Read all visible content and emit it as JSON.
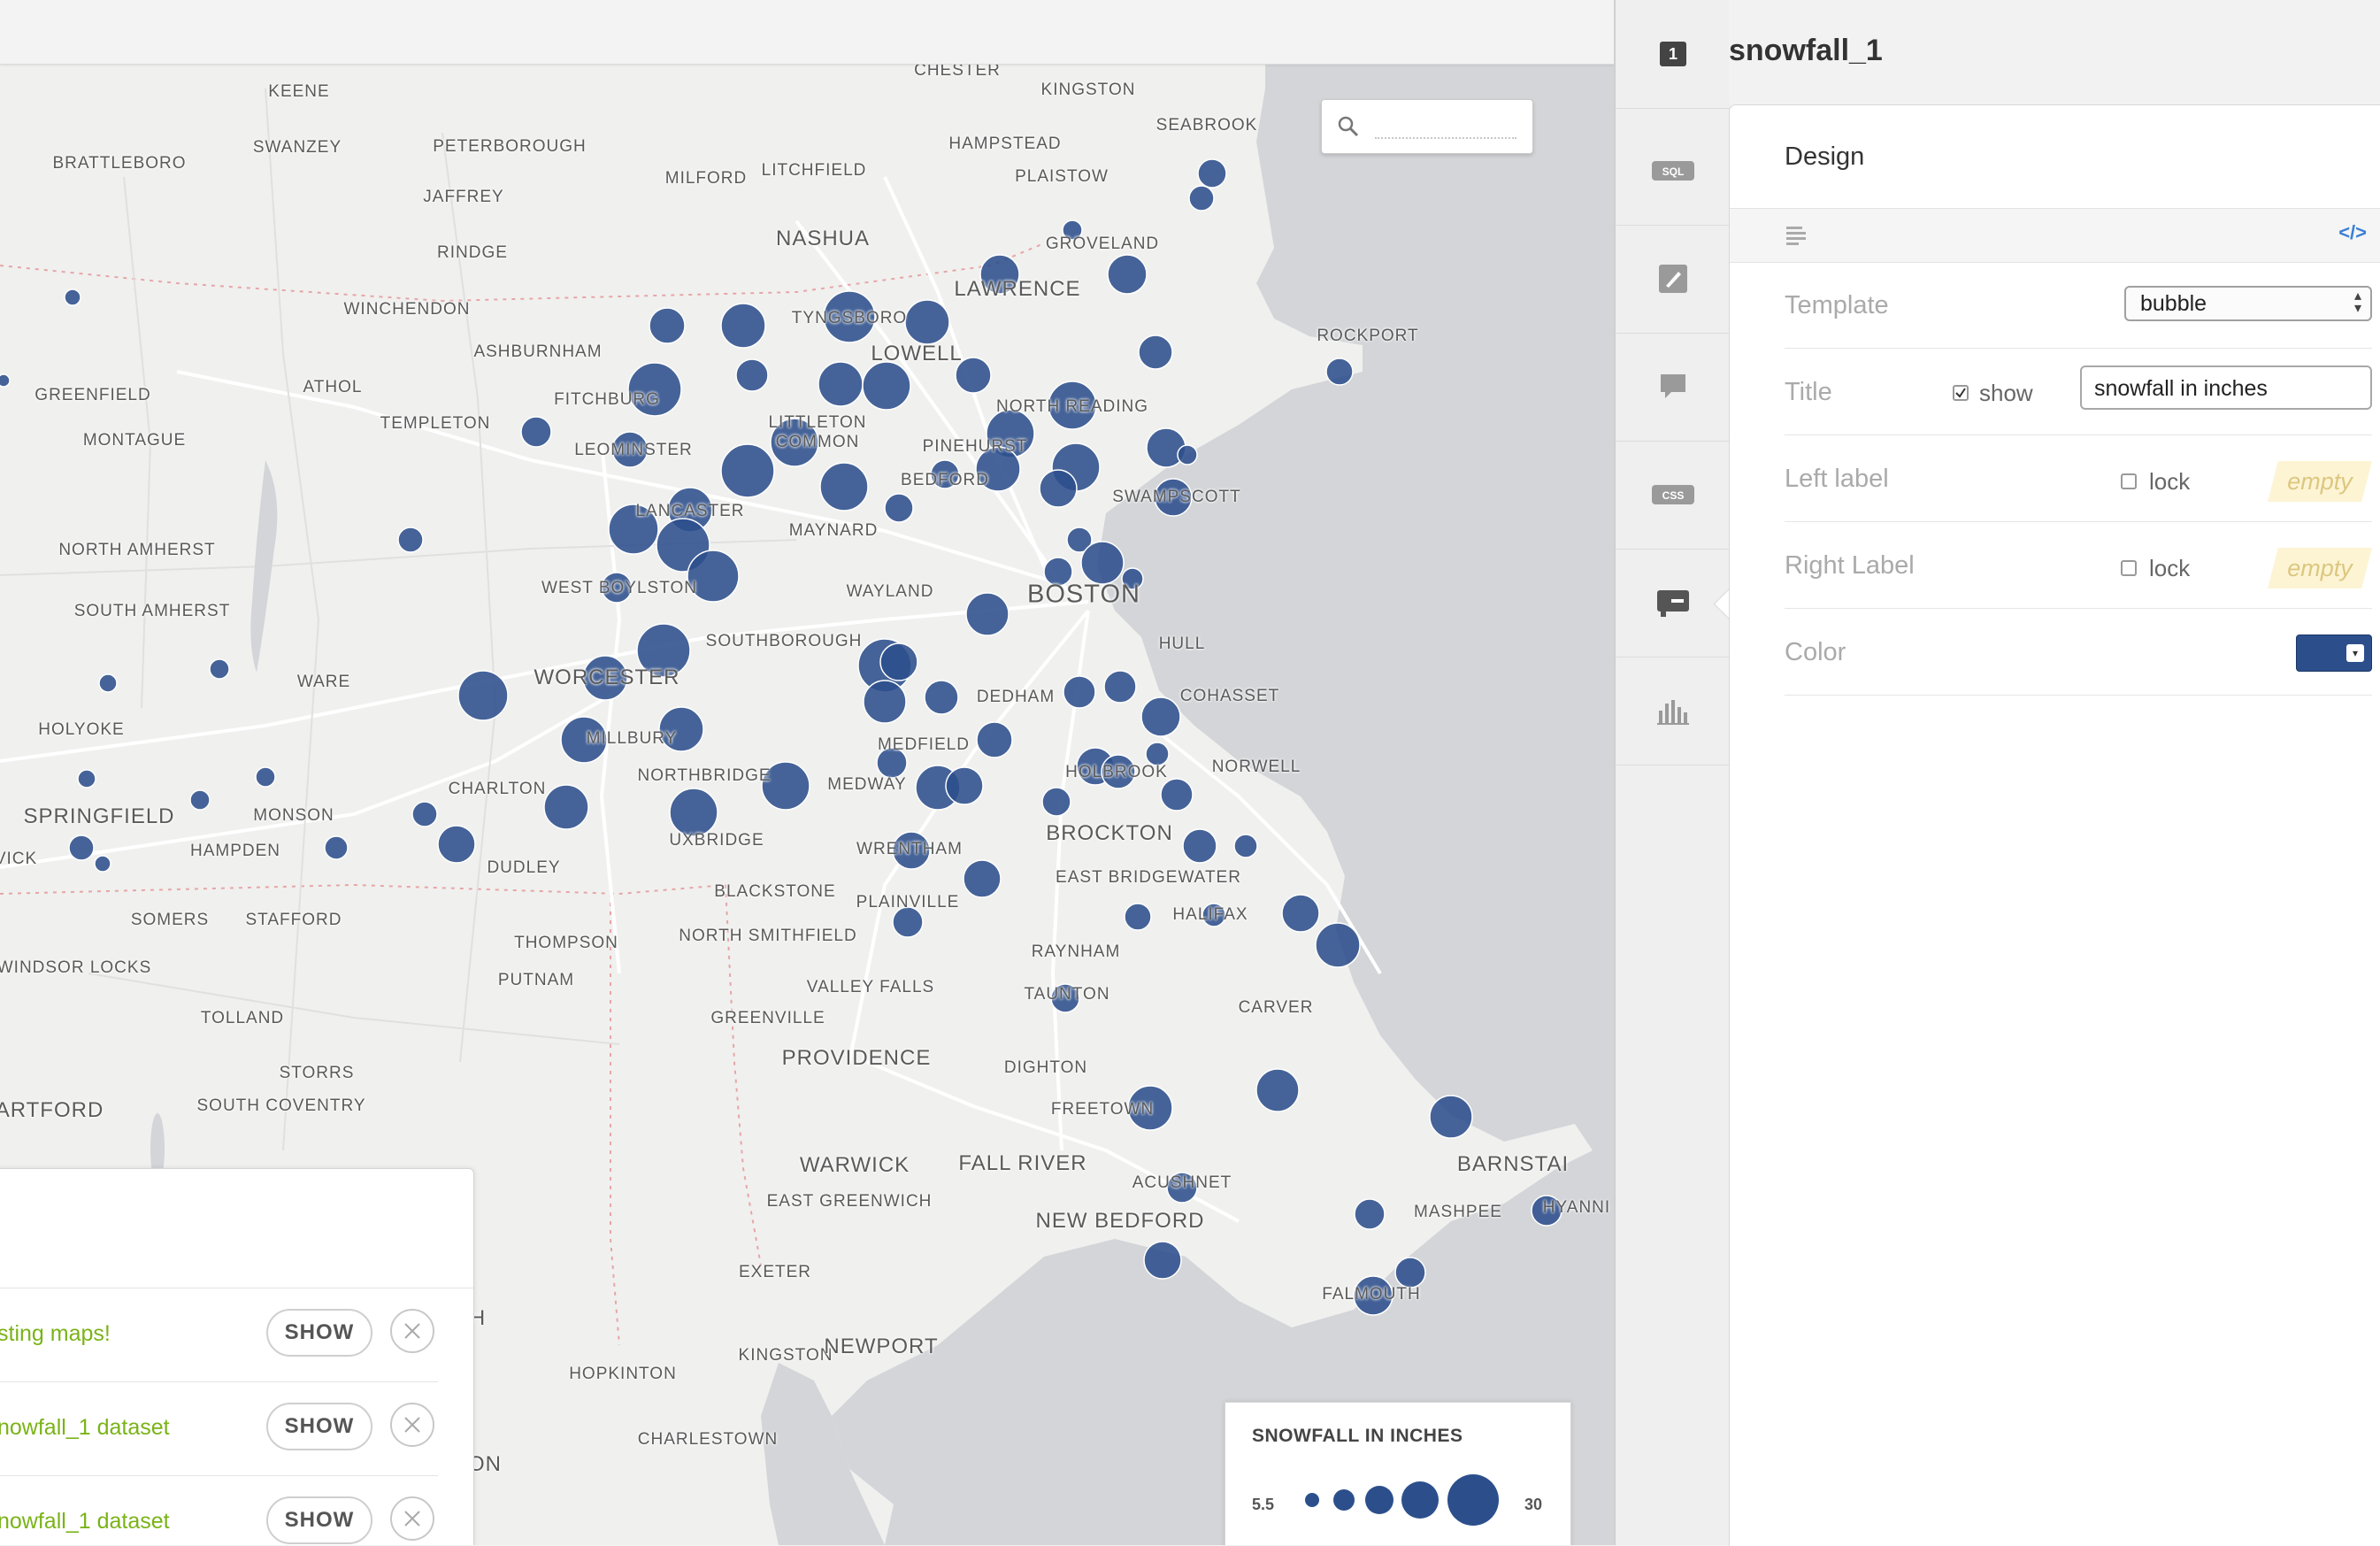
{
  "layer": {
    "number": "1",
    "name": "snowfall_1"
  },
  "rail_icons": [
    "sql-icon",
    "wizard-icon",
    "infowindow-icon",
    "css-icon",
    "legend-icon",
    "widgets-icon"
  ],
  "panel": {
    "title": "Design",
    "code_toggle": "</>",
    "template": {
      "label": "Template",
      "value": "bubble"
    },
    "title_row": {
      "label": "Title",
      "show_label": "show",
      "show_checked": true,
      "value": "snowfall in inches"
    },
    "left_label": {
      "label": "Left label",
      "lock_label": "lock",
      "placeholder": "empty"
    },
    "right_label": {
      "label": "Right Label",
      "lock_label": "lock",
      "placeholder": "empty"
    },
    "color": {
      "label": "Color",
      "value": "#2c4f8c"
    }
  },
  "legend": {
    "title": "SNOWFALL IN INCHES",
    "min": "5.5",
    "max": "30"
  },
  "notifications": [
    {
      "text": "sting maps!",
      "button": "SHOW"
    },
    {
      "text": "nowfall_1 dataset",
      "button": "SHOW"
    },
    {
      "text": "nowfall_1 dataset",
      "button": "SHOW"
    }
  ],
  "map": {
    "partial_label": "H",
    "partial_label2": "ON",
    "places": [
      {
        "n": "CHESTER",
        "s": "s"
      },
      {
        "n": "KINGSTON",
        "s": "s"
      },
      {
        "n": "KEENE",
        "s": "s"
      },
      {
        "n": "SEABROOK",
        "s": "s"
      },
      {
        "n": "BRATTLEBORO",
        "s": "s"
      },
      {
        "n": "SWANZEY",
        "s": "s"
      },
      {
        "n": "PETERBOROUGH",
        "s": "s"
      },
      {
        "n": "HAMPSTEAD",
        "s": "s"
      },
      {
        "n": "MILFORD",
        "s": "s"
      },
      {
        "n": "LITCHFIELD",
        "s": "s"
      },
      {
        "n": "PLAISTOW",
        "s": "s"
      },
      {
        "n": "JAFFREY",
        "s": "s"
      },
      {
        "n": "NASHUA",
        "s": "m"
      },
      {
        "n": "GROVELAND",
        "s": "s"
      },
      {
        "n": "RINDGE",
        "s": "s"
      },
      {
        "n": "LAWRENCE",
        "s": "m"
      },
      {
        "n": "WINCHENDON",
        "s": "s"
      },
      {
        "n": "TYNGSBORO",
        "s": "s"
      },
      {
        "n": "ROCKPORT",
        "s": "s"
      },
      {
        "n": "ASHBURNHAM",
        "s": "s"
      },
      {
        "n": "LOWELL",
        "s": "m"
      },
      {
        "n": "GREENFIELD",
        "s": "s"
      },
      {
        "n": "ATHOL",
        "s": "s"
      },
      {
        "n": "FITCHBURG",
        "s": "s"
      },
      {
        "n": "NORTH READING",
        "s": "s"
      },
      {
        "n": "TEMPLETON",
        "s": "s"
      },
      {
        "n": "LITTLETON",
        "s": "s"
      },
      {
        "n": "COMMON",
        "s": "s"
      },
      {
        "n": "MONTAGUE",
        "s": "s"
      },
      {
        "n": "LEOMINSTER",
        "s": "s"
      },
      {
        "n": "PINEHURST",
        "s": "s"
      },
      {
        "n": "BEDFORD",
        "s": "s"
      },
      {
        "n": "SWAMPSCOTT",
        "s": "s"
      },
      {
        "n": "LANCASTER",
        "s": "s"
      },
      {
        "n": "MAYNARD",
        "s": "s"
      },
      {
        "n": "NORTH AMHERST",
        "s": "s"
      },
      {
        "n": "WEST BOYLSTON",
        "s": "s"
      },
      {
        "n": "WAYLAND",
        "s": "s"
      },
      {
        "n": "BOSTON",
        "s": "l"
      },
      {
        "n": "SOUTH AMHERST",
        "s": "s"
      },
      {
        "n": "SOUTHBOROUGH",
        "s": "s"
      },
      {
        "n": "HULL",
        "s": "s"
      },
      {
        "n": "WARE",
        "s": "s"
      },
      {
        "n": "WORCESTER",
        "s": "m"
      },
      {
        "n": "DEDHAM",
        "s": "s"
      },
      {
        "n": "COHASSET",
        "s": "s"
      },
      {
        "n": "HOLYOKE",
        "s": "s"
      },
      {
        "n": "MILLBURY",
        "s": "s"
      },
      {
        "n": "MEDFIELD",
        "s": "s"
      },
      {
        "n": "NORWELL",
        "s": "s"
      },
      {
        "n": "NORTHBRIDGE",
        "s": "s"
      },
      {
        "n": "HOLBROOK",
        "s": "s"
      },
      {
        "n": "CHARLTON",
        "s": "s"
      },
      {
        "n": "MEDWAY",
        "s": "s"
      },
      {
        "n": "SPRINGFIELD",
        "s": "m"
      },
      {
        "n": "MONSON",
        "s": "s"
      },
      {
        "n": "UXBRIDGE",
        "s": "s"
      },
      {
        "n": "BROCKTON",
        "s": "m"
      },
      {
        "n": "HAMPDEN",
        "s": "s"
      },
      {
        "n": "WRENTHAM",
        "s": "s"
      },
      {
        "n": "VICK",
        "s": "s"
      },
      {
        "n": "DUDLEY",
        "s": "s"
      },
      {
        "n": "EAST BRIDGEWATER",
        "s": "s"
      },
      {
        "n": "BLACKSTONE",
        "s": "s"
      },
      {
        "n": "PLAINVILLE",
        "s": "s"
      },
      {
        "n": "HALIFAX",
        "s": "s"
      },
      {
        "n": "SOMERS",
        "s": "s"
      },
      {
        "n": "STAFFORD",
        "s": "s"
      },
      {
        "n": "NORTH SMITHFIELD",
        "s": "s"
      },
      {
        "n": "THOMPSON",
        "s": "s"
      },
      {
        "n": "RAYNHAM",
        "s": "s"
      },
      {
        "n": "WINDSOR LOCKS",
        "s": "s"
      },
      {
        "n": "PUTNAM",
        "s": "s"
      },
      {
        "n": "VALLEY FALLS",
        "s": "s"
      },
      {
        "n": "TAUNTON",
        "s": "s"
      },
      {
        "n": "TOLLAND",
        "s": "s"
      },
      {
        "n": "CARVER",
        "s": "s"
      },
      {
        "n": "GREENVILLE",
        "s": "s"
      },
      {
        "n": "PROVIDENCE",
        "s": "m"
      },
      {
        "n": "DIGHTON",
        "s": "s"
      },
      {
        "n": "STORRS",
        "s": "s"
      },
      {
        "n": "ARTFORD",
        "s": "m"
      },
      {
        "n": "SOUTH COVENTRY",
        "s": "s"
      },
      {
        "n": "FREETOWN",
        "s": "s"
      },
      {
        "n": "WARWICK",
        "s": "m"
      },
      {
        "n": "FALL RIVER",
        "s": "m"
      },
      {
        "n": "BARNSTAI",
        "s": "m"
      },
      {
        "n": "ACUSHNET",
        "s": "s"
      },
      {
        "n": "EAST GREENWICH",
        "s": "s"
      },
      {
        "n": "MASHPEE",
        "s": "s"
      },
      {
        "n": "HYANNI",
        "s": "s"
      },
      {
        "n": "NEW BEDFORD",
        "s": "m"
      },
      {
        "n": "EXETER",
        "s": "s"
      },
      {
        "n": "FALMOUTH",
        "s": "s"
      },
      {
        "n": "KINGSTON",
        "s": "s"
      },
      {
        "n": "NEWPORT",
        "s": "m"
      },
      {
        "n": "HOPKINTON",
        "s": "s"
      },
      {
        "n": "CHARLESTOWN",
        "s": "s"
      }
    ]
  }
}
